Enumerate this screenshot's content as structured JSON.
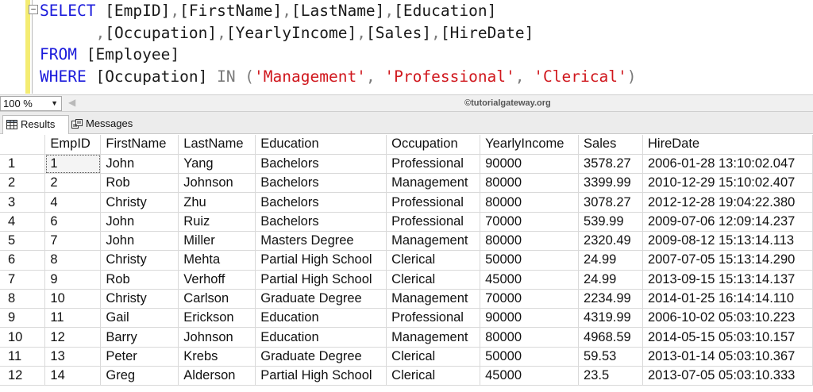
{
  "editor": {
    "collapse_glyph": "−",
    "lines": [
      [
        {
          "c": "kw",
          "t": "SELECT "
        },
        {
          "c": "id",
          "t": "[EmpID]"
        },
        {
          "c": "gray",
          "t": ","
        },
        {
          "c": "id",
          "t": "[FirstName]"
        },
        {
          "c": "gray",
          "t": ","
        },
        {
          "c": "id",
          "t": "[LastName]"
        },
        {
          "c": "gray",
          "t": ","
        },
        {
          "c": "id",
          "t": "[Education]"
        }
      ],
      [
        {
          "c": "id",
          "t": "      "
        },
        {
          "c": "gray",
          "t": ","
        },
        {
          "c": "id",
          "t": "[Occupation]"
        },
        {
          "c": "gray",
          "t": ","
        },
        {
          "c": "id",
          "t": "[YearlyIncome]"
        },
        {
          "c": "gray",
          "t": ","
        },
        {
          "c": "id",
          "t": "[Sales]"
        },
        {
          "c": "gray",
          "t": ","
        },
        {
          "c": "id",
          "t": "[HireDate]"
        }
      ],
      [
        {
          "c": "kw",
          "t": "FROM "
        },
        {
          "c": "id",
          "t": "[Employee]"
        }
      ],
      [
        {
          "c": "kw",
          "t": "WHERE "
        },
        {
          "c": "id",
          "t": "[Occupation] "
        },
        {
          "c": "gray",
          "t": "IN ("
        },
        {
          "c": "str",
          "t": "'Management'"
        },
        {
          "c": "gray",
          "t": ", "
        },
        {
          "c": "str",
          "t": "'Professional'"
        },
        {
          "c": "gray",
          "t": ", "
        },
        {
          "c": "str",
          "t": "'Clerical'"
        },
        {
          "c": "gray",
          "t": ")"
        }
      ]
    ]
  },
  "zoom": {
    "value": "100 %",
    "caret": "▼",
    "scroll_glyph": "◀"
  },
  "watermark": "©tutorialgateway.org",
  "tabs": {
    "results": "Results",
    "messages": "Messages"
  },
  "grid": {
    "columns": [
      "",
      "EmpID",
      "FirstName",
      "LastName",
      "Education",
      "Occupation",
      "YearlyIncome",
      "Sales",
      "HireDate"
    ],
    "rows": [
      [
        "1",
        "1",
        "John",
        "Yang",
        "Bachelors",
        "Professional",
        "90000",
        "3578.27",
        "2006-01-28 13:10:02.047"
      ],
      [
        "2",
        "2",
        "Rob",
        "Johnson",
        "Bachelors",
        "Management",
        "80000",
        "3399.99",
        "2010-12-29 15:10:02.407"
      ],
      [
        "3",
        "4",
        "Christy",
        "Zhu",
        "Bachelors",
        "Professional",
        "80000",
        "3078.27",
        "2012-12-28 19:04:22.380"
      ],
      [
        "4",
        "6",
        "John",
        "Ruiz",
        "Bachelors",
        "Professional",
        "70000",
        "539.99",
        "2009-07-06 12:09:14.237"
      ],
      [
        "5",
        "7",
        "John",
        "Miller",
        "Masters Degree",
        "Management",
        "80000",
        "2320.49",
        "2009-08-12 15:13:14.113"
      ],
      [
        "6",
        "8",
        "Christy",
        "Mehta",
        "Partial High School",
        "Clerical",
        "50000",
        "24.99",
        "2007-07-05 15:13:14.290"
      ],
      [
        "7",
        "9",
        "Rob",
        "Verhoff",
        "Partial High School",
        "Clerical",
        "45000",
        "24.99",
        "2013-09-15 15:13:14.137"
      ],
      [
        "8",
        "10",
        "Christy",
        "Carlson",
        "Graduate Degree",
        "Management",
        "70000",
        "2234.99",
        "2014-01-25 16:14:14.110"
      ],
      [
        "9",
        "11",
        "Gail",
        "Erickson",
        "Education",
        "Professional",
        "90000",
        "4319.99",
        "2006-10-02 05:03:10.223"
      ],
      [
        "10",
        "12",
        "Barry",
        "Johnson",
        "Education",
        "Management",
        "80000",
        "4968.59",
        "2014-05-15 05:03:10.157"
      ],
      [
        "11",
        "13",
        "Peter",
        "Krebs",
        "Graduate Degree",
        "Clerical",
        "50000",
        "59.53",
        "2013-01-14 05:03:10.367"
      ],
      [
        "12",
        "14",
        "Greg",
        "Alderson",
        "Partial High School",
        "Clerical",
        "45000",
        "23.5",
        "2013-07-05 05:03:10.333"
      ]
    ]
  }
}
